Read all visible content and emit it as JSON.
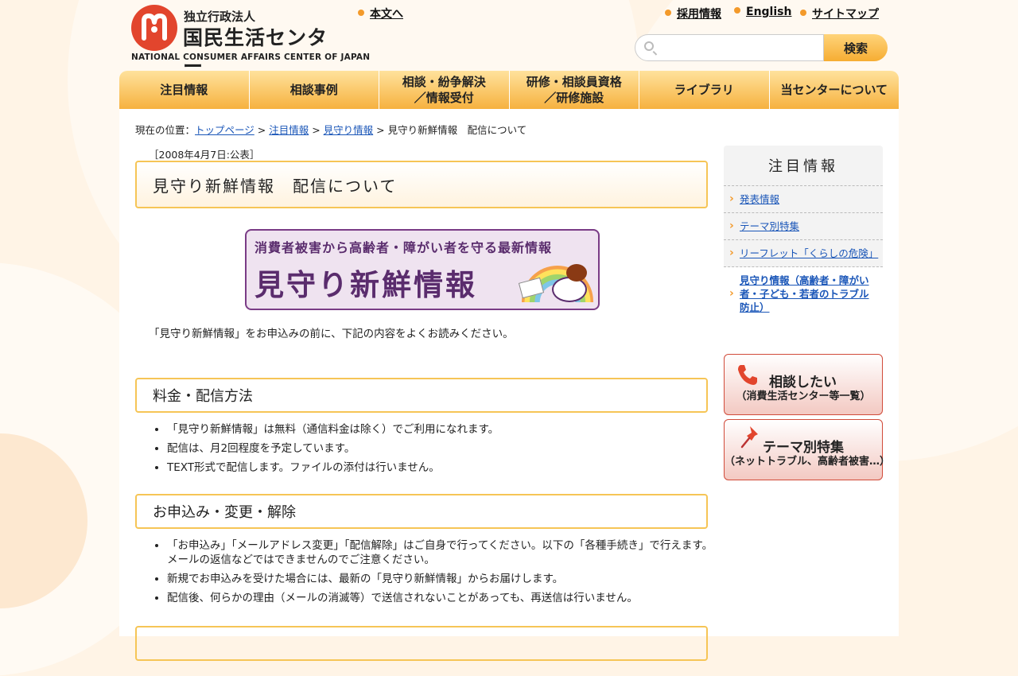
{
  "header": {
    "logo_small": "独立行政法人",
    "logo_big": "国民生活センター",
    "logo_en": "NATIONAL CONSUMER AFFAIRS CENTER OF JAPAN",
    "skip_link": "本文へ",
    "top_links": [
      "採用情報",
      "English",
      "サイトマップ"
    ],
    "search_placeholder": "",
    "search_button": "検索"
  },
  "nav": [
    "注目情報",
    "相談事例",
    "相談・紛争解決\n／情報受付",
    "研修・相談員資格\n／研修施設",
    "ライブラリ",
    "当センターについて"
  ],
  "breadcrumb": {
    "prefix": "現在の位置：",
    "links": [
      "トップページ",
      "注目情報",
      "見守り情報"
    ],
    "current": "見守り新鮮情報　配信について"
  },
  "main": {
    "date": "［2008年4月7日:公表］",
    "title": "見守り新鮮情報　配信について",
    "banner_top": "消費者被害から高齢者・障がい者を守る最新情報",
    "banner_title": "見守り新鮮情報",
    "intro": "「見守り新鮮情報」をお申込みの前に、下記の内容をよくお読みください。",
    "sections": [
      {
        "heading": "料金・配信方法",
        "items": [
          "「見守り新鮮情報」は無料（通信料金は除く）でご利用になれます。",
          "配信は、月2回程度を予定しています。",
          "TEXT形式で配信します。ファイルの添付は行いません。"
        ]
      },
      {
        "heading": "お申込み・変更・解除",
        "items": [
          "「お申込み」「メールアドレス変更」「配信解除」はご自身で行ってください。以下の「各種手続き」で行えます。メールの返信などではできませんのでご注意ください。",
          "新規でお申込みを受けた場合には、最新の「見守り新鮮情報」からお届けします。",
          "配信後、何らかの理由（メールの消滅等）で送信されないことがあっても、再送信は行いません。"
        ]
      }
    ]
  },
  "sidebar": {
    "heading": "注目情報",
    "items": [
      "発表情報",
      "テーマ別特集",
      "リーフレット「くらしの危険」",
      "見守り情報（高齢者・障がい者・子ども・若者のトラブル防止）"
    ],
    "active_index": 3,
    "promo": [
      {
        "title": "相談したい",
        "sub": "（消費生活センター等一覧）",
        "icon": "phone-icon"
      },
      {
        "title": "テーマ別特集",
        "sub": "（ネットトラブル、高齢者被害…）",
        "icon": "pin-icon"
      }
    ]
  },
  "colors": {
    "accent_orange": "#f6b13f",
    "link_blue": "#1a56b8",
    "logo_red": "#e2452d",
    "banner_purple": "#5a2c6d"
  }
}
